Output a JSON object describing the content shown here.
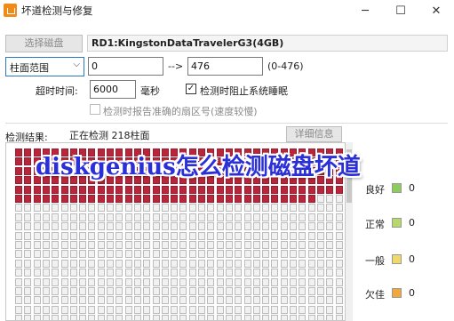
{
  "window": {
    "title": "坏道检测与修复",
    "minimize_glyph": "─",
    "maximize_glyph": "☐",
    "close_glyph": "✕"
  },
  "disk": {
    "select_button": "选择磁盘",
    "name": "RD1:KingstonDataTravelerG3(4GB)"
  },
  "range": {
    "mode": "柱面范围",
    "start": "0",
    "arrow": "-->",
    "end": "476",
    "limit_hint": "(0-476)"
  },
  "timeout": {
    "label": "超时时间:",
    "value": "6000",
    "unit": "毫秒"
  },
  "options": {
    "prevent_sleep_label": "检测时阻止系统睡眠",
    "prevent_sleep_checked": true,
    "report_sector_label": "检测时报告准确的扇区号(速度较慢)",
    "report_sector_checked": false
  },
  "results": {
    "label": "检测结果:",
    "status": "正在检测 218柱面",
    "detail_button": "详细信息",
    "checked_cells": 218
  },
  "legend": [
    {
      "label": "良好",
      "color": "#8ccc5a",
      "count": "0"
    },
    {
      "label": "正常",
      "color": "#b7d96a",
      "count": "0"
    },
    {
      "label": "一般",
      "color": "#f0d86a",
      "count": "0"
    },
    {
      "label": "欠佳",
      "color": "#f0a83a",
      "count": "0"
    }
  ],
  "overlay_caption": "diskgenius怎么检测磁盘坏道"
}
